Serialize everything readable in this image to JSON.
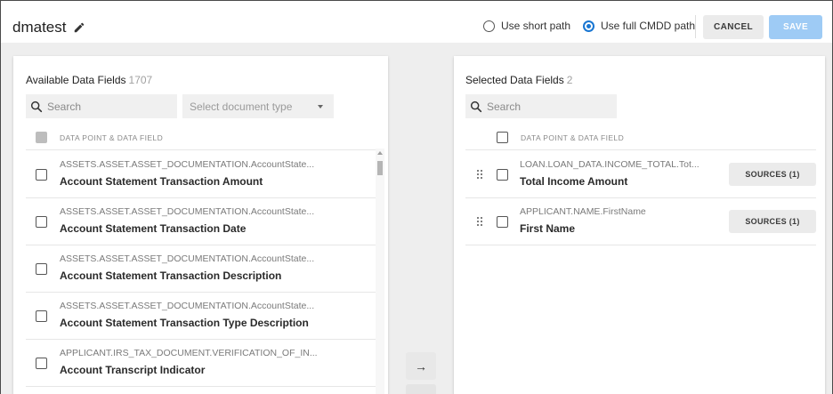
{
  "header": {
    "title": "dmatest",
    "radio_short": "Use short path",
    "radio_full": "Use full CMDD path",
    "selected_path_mode": "full",
    "cancel_label": "CANCEL",
    "save_label": "SAVE"
  },
  "available": {
    "title": "Available Data Fields",
    "count": "1707",
    "search_placeholder": "Search",
    "doc_type_placeholder": "Select document type",
    "column_header": "DATA POINT & DATA FIELD",
    "rows": [
      {
        "path": "ASSETS.ASSET.ASSET_DOCUMENTATION.AccountState...",
        "label": "Account Statement Transaction Amount"
      },
      {
        "path": "ASSETS.ASSET.ASSET_DOCUMENTATION.AccountState...",
        "label": "Account Statement Transaction Date"
      },
      {
        "path": "ASSETS.ASSET.ASSET_DOCUMENTATION.AccountState...",
        "label": "Account Statement Transaction Description"
      },
      {
        "path": "ASSETS.ASSET.ASSET_DOCUMENTATION.AccountState...",
        "label": "Account Statement Transaction Type Description"
      },
      {
        "path": "APPLICANT.IRS_TAX_DOCUMENT.VERIFICATION_OF_IN...",
        "label": "Account Transcript Indicator"
      }
    ]
  },
  "selected": {
    "title": "Selected Data Fields",
    "count": "2",
    "search_placeholder": "Search",
    "column_header": "DATA POINT & DATA FIELD",
    "rows": [
      {
        "path": "LOAN.LOAN_DATA.INCOME_TOTAL.Tot...",
        "label": "Total Income Amount",
        "sources": "SOURCES (1)"
      },
      {
        "path": "APPLICANT.NAME.FirstName",
        "label": "First Name",
        "sources": "SOURCES (1)"
      }
    ]
  },
  "transfer": {
    "add_arrow": "→"
  },
  "colors": {
    "accent": "#1976d2",
    "save_disabled": "#9ecbf5",
    "background": "#eeeeee"
  }
}
